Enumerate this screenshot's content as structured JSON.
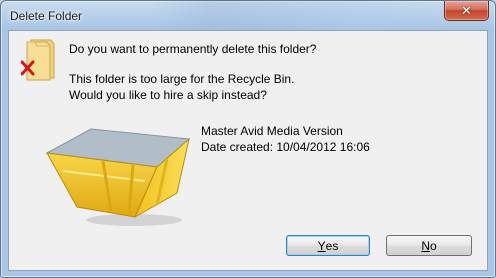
{
  "dialog": {
    "title": "Delete Folder",
    "close_label": "✕",
    "question": "Do you want to permanently delete this folder?",
    "message_line1": "This folder is too large for the Recycle Bin.",
    "message_line2": "Would you like to hire a skip instead?",
    "item_name": "Master Avid Media Version",
    "item_date": "Date created: 10/04/2012 16:06",
    "buttons": {
      "yes_mnemonic": "Y",
      "yes_rest": "es",
      "no_mnemonic": "N",
      "no_rest": "o"
    }
  },
  "icons": {
    "folder": "folder-delete-icon",
    "skip": "yellow-skip-container"
  },
  "colors": {
    "skip_yellow": "#f2c21c",
    "delete_x": "#d11818",
    "close_red": "#c0462d",
    "default_button_border": "#3c7fb1"
  }
}
